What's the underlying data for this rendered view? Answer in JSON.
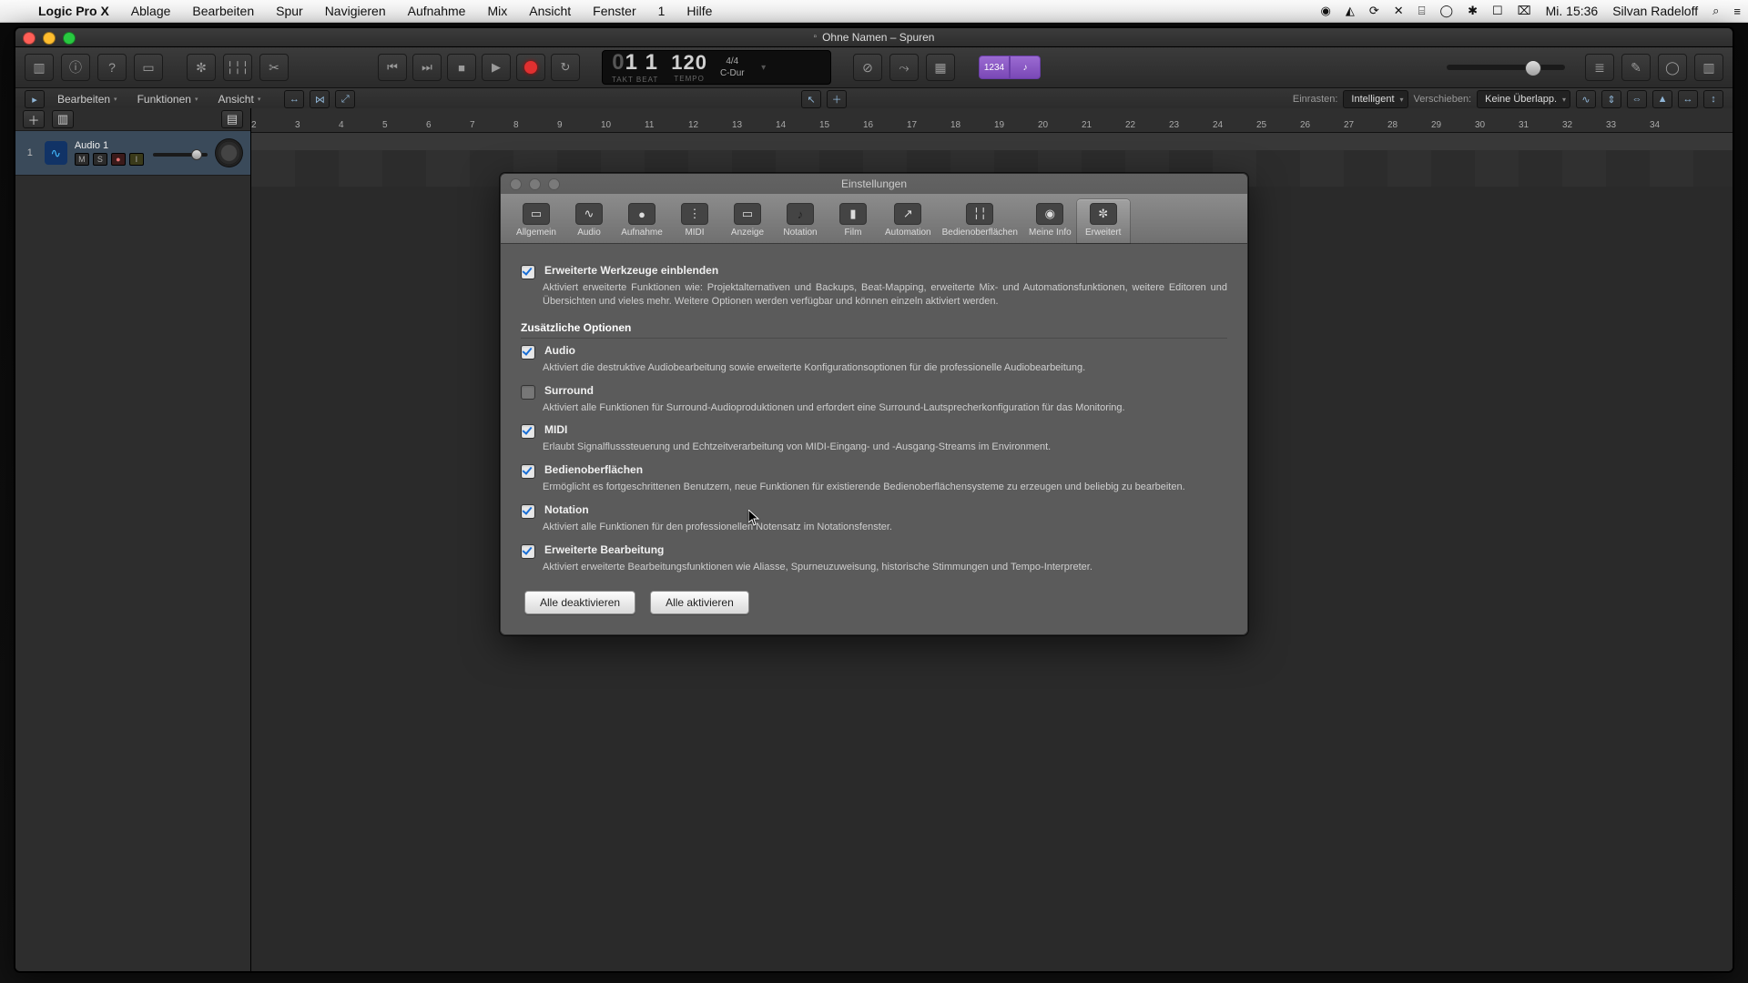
{
  "menubar": {
    "apple": "",
    "items": [
      "Logic Pro X",
      "Ablage",
      "Bearbeiten",
      "Spur",
      "Navigieren",
      "Aufnahme",
      "Mix",
      "Ansicht",
      "Fenster",
      "1",
      "Hilfe"
    ],
    "status_icons": [
      "◉",
      "◭",
      "⟳",
      "✕",
      "⌸",
      "◯",
      "✱",
      "☐",
      "⌧"
    ],
    "clock": "Mi. 15:36",
    "user": "Silvan Radeloff",
    "search": "⌕",
    "list": "≡"
  },
  "window": {
    "title": "Ohne Namen – Spuren"
  },
  "transport": {
    "bars_dim": "0",
    "bars": "1  1",
    "bars_label": "TAKT        BEAT",
    "tempo": "120",
    "tempo_label": "TEMPO",
    "sig": "4/4",
    "key": "C-Dur"
  },
  "lcd_buttons": {
    "count": "1234"
  },
  "toolbar2": {
    "menus": [
      "Bearbeiten",
      "Funktionen",
      "Ansicht"
    ],
    "snap_label": "Einrasten:",
    "snap_value": "Intelligent",
    "drag_label": "Verschieben:",
    "drag_value": "Keine Überlapp."
  },
  "track": {
    "index": "1",
    "name": "Audio 1",
    "mute": "M",
    "solo": "S",
    "rec": "R"
  },
  "ruler": [
    "2",
    "3",
    "4",
    "5",
    "6",
    "7",
    "8",
    "9",
    "10",
    "11",
    "12",
    "13",
    "14",
    "15",
    "16",
    "17",
    "18",
    "19",
    "20",
    "21",
    "22",
    "23",
    "24",
    "25",
    "26",
    "27",
    "28",
    "29",
    "30",
    "31",
    "32",
    "33",
    "34"
  ],
  "prefs": {
    "title": "Einstellungen",
    "tabs": [
      "Allgemein",
      "Audio",
      "Aufnahme",
      "MIDI",
      "Anzeige",
      "Notation",
      "Film",
      "Automation",
      "Bedienoberflächen",
      "Meine Info",
      "Erweitert"
    ],
    "active_tab_index": 10,
    "adv_title": "Erweiterte Werkzeuge einblenden",
    "adv_desc": "Aktiviert erweiterte Funktionen wie: Projektalternativen und Backups, Beat-Mapping, erweiterte Mix- und Automationsfunktionen, weitere Editoren und Übersichten und vieles mehr. Weitere Optionen werden verfügbar und können einzeln aktiviert werden.",
    "subhead": "Zusätzliche Optionen",
    "opts": [
      {
        "on": true,
        "title": "Audio",
        "desc": "Aktiviert die destruktive Audiobearbeitung sowie erweiterte Konfigurationsoptionen für die professionelle Audiobearbeitung."
      },
      {
        "on": false,
        "title": "Surround",
        "desc": "Aktiviert alle Funktionen für Surround-Audioproduktionen und erfordert eine Surround-Lautsprecherkonfiguration für das Monitoring."
      },
      {
        "on": true,
        "title": "MIDI",
        "desc": "Erlaubt Signalflusssteuerung und Echtzeitverarbeitung von MIDI-Eingang- und -Ausgang-Streams im Environment."
      },
      {
        "on": true,
        "title": "Bedienoberflächen",
        "desc": "Ermöglicht es fortgeschrittenen Benutzern, neue Funktionen für existierende Bedienoberflächensysteme zu erzeugen und beliebig zu bearbeiten."
      },
      {
        "on": true,
        "title": "Notation",
        "desc": "Aktiviert alle Funktionen für den professionellen Notensatz im Notationsfenster."
      },
      {
        "on": true,
        "title": "Erweiterte Bearbeitung",
        "desc": "Aktiviert erweiterte Bearbeitungsfunktionen wie Aliasse, Spurneuzuweisung, historische Stimmungen und Tempo-Interpreter."
      }
    ],
    "btn_off": "Alle deaktivieren",
    "btn_on": "Alle aktivieren"
  }
}
